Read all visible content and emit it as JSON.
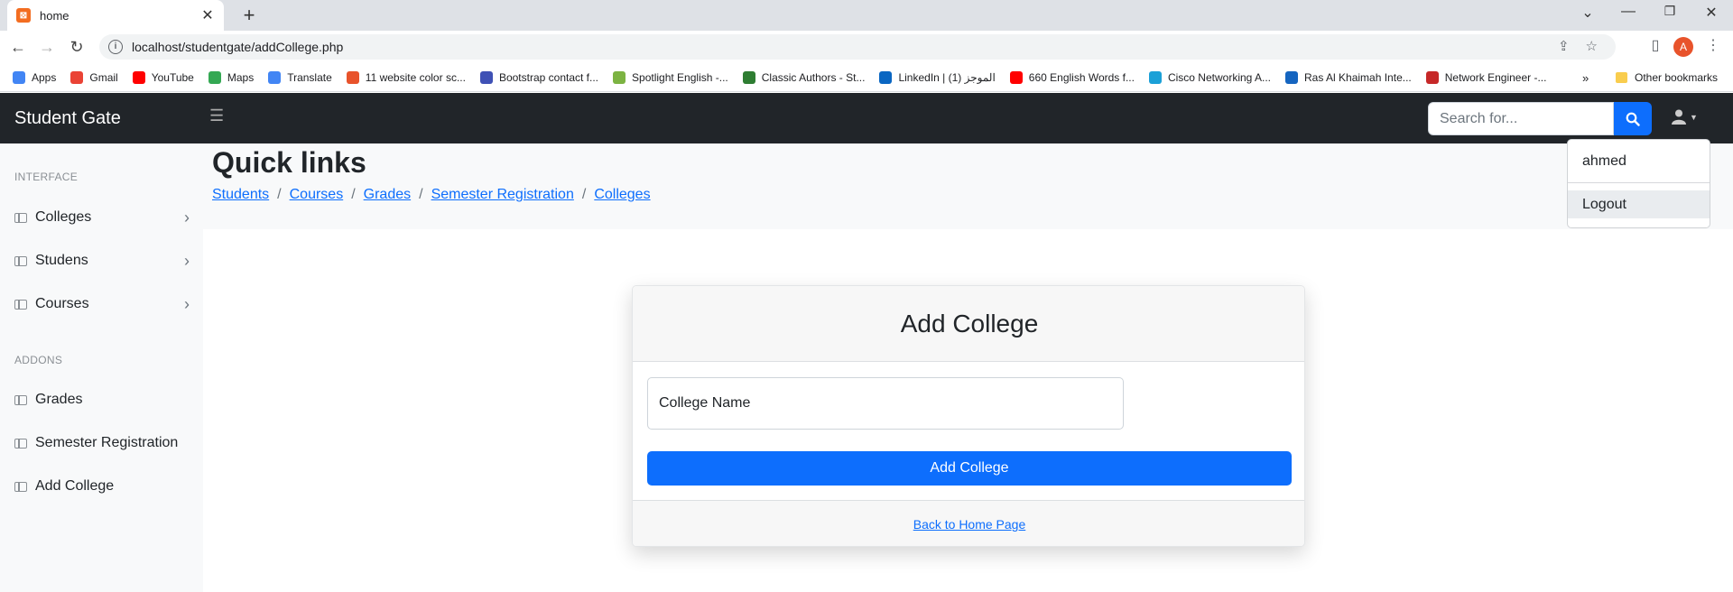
{
  "browser": {
    "tab_title": "home",
    "url": "localhost/studentgate/addCollege.php",
    "profile_initial": "A",
    "bookmarks": [
      {
        "label": "Apps",
        "color": "#4285f4"
      },
      {
        "label": "Gmail",
        "color": "#ea4335"
      },
      {
        "label": "YouTube",
        "color": "#ff0000"
      },
      {
        "label": "Maps",
        "color": "#34a853"
      },
      {
        "label": "Translate",
        "color": "#4285f4"
      },
      {
        "label": "11 website color sc...",
        "color": "#e8532b"
      },
      {
        "label": "Bootstrap contact f...",
        "color": "#3f51b5"
      },
      {
        "label": "Spotlight English -...",
        "color": "#7cb342"
      },
      {
        "label": "Classic Authors - St...",
        "color": "#2e7d32"
      },
      {
        "label": "LinkedIn | الموجز (1)",
        "color": "#0a66c2"
      },
      {
        "label": "660 English Words f...",
        "color": "#ff0000"
      },
      {
        "label": "Cisco Networking A...",
        "color": "#1ba0d7"
      },
      {
        "label": "Ras Al Khaimah Inte...",
        "color": "#1565c0"
      },
      {
        "label": "Network Engineer -...",
        "color": "#c62828"
      }
    ],
    "more_bookmarks": "»",
    "other_bookmarks": "Other bookmarks"
  },
  "navbar": {
    "brand": "Student Gate",
    "search_placeholder": "Search for..."
  },
  "user_menu": {
    "username": "ahmed",
    "logout": "Logout"
  },
  "sidebar": {
    "heading_interface": "INTERFACE",
    "interface_items": [
      "Colleges",
      "Studens",
      "Courses"
    ],
    "heading_addons": "ADDONS",
    "addon_items": [
      "Grades",
      "Semester Registration",
      "Add College"
    ]
  },
  "quick_links": {
    "title": "Quick links",
    "links": [
      "Students",
      "Courses",
      "Grades",
      "Semester Registration",
      "Colleges"
    ],
    "separator": "/"
  },
  "form": {
    "title": "Add College",
    "name_placeholder": "College Name",
    "submit_label": "Add College",
    "back_link": "Back to Home Page"
  },
  "colors": {
    "navbar_bg": "#212529",
    "primary": "#0d6efd",
    "sidebar_bg": "#f8f9fa"
  }
}
